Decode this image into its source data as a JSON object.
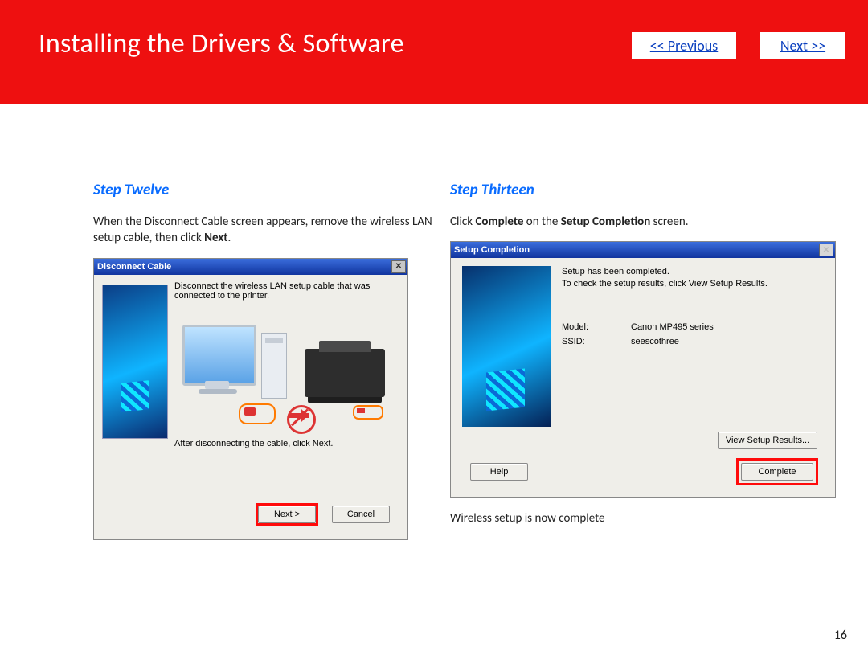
{
  "header": {
    "title": "Installing  the Drivers & Software",
    "prev": "<< Previous",
    "next": "Next >>"
  },
  "page_number": "16",
  "step12": {
    "heading": "Step Twelve",
    "intro_pre": "When the Disconnect Cable screen appears, remove the wireless LAN setup cable, then click ",
    "intro_bold": "Next",
    "intro_post": ".",
    "dialog_title": "Disconnect Cable",
    "line1": "Disconnect the wireless LAN setup cable that was connected to the printer.",
    "line2": "After disconnecting the cable, click Next.",
    "btn_next": "Next >",
    "btn_cancel": "Cancel"
  },
  "step13": {
    "heading": "Step Thirteen",
    "intro_a": "Click ",
    "intro_b1": "Complete",
    "intro_c": " on the ",
    "intro_b2": "Setup Completion",
    "intro_d": " screen.",
    "dialog_title": "Setup Completion",
    "msg1": "Setup has been completed.",
    "msg2": "To check the setup results, click View Setup Results.",
    "model_k": "Model:",
    "model_v": "Canon MP495 series",
    "ssid_k": "SSID:",
    "ssid_v": "seescothree",
    "btn_view": "View Setup Results...",
    "btn_help": "Help",
    "btn_complete": "Complete",
    "post": "Wireless setup is now complete"
  }
}
